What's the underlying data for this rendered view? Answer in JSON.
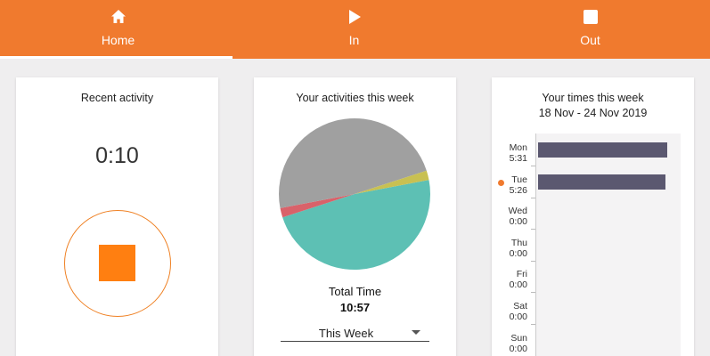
{
  "nav": {
    "tabs": [
      {
        "label": "Home",
        "icon": "home-icon"
      },
      {
        "label": "In",
        "icon": "play-icon"
      },
      {
        "label": "Out",
        "icon": "stop-icon"
      }
    ],
    "active": "Home"
  },
  "recent": {
    "title": "Recent activity",
    "timer": "0:10",
    "stop_icon": "stop-icon"
  },
  "activities": {
    "title": "Your activities this week",
    "total_label": "Total Time",
    "total_value": "10:57",
    "period": "This Week",
    "slices": [
      {
        "color": "#5dc0b4",
        "share": 0.48
      },
      {
        "color": "#d9626a",
        "share": 0.02
      },
      {
        "color": "#a0a0a0",
        "share": 0.48
      },
      {
        "color": "#c8c052",
        "share": 0.02
      }
    ]
  },
  "times": {
    "title": "Your times this week",
    "range": "18 Nov - 24 Nov 2019",
    "days": [
      {
        "day": "Mon",
        "time": "5:31",
        "hours": 5.52
      },
      {
        "day": "Tue",
        "time": "5:26",
        "hours": 5.43,
        "today": true
      },
      {
        "day": "Wed",
        "time": "0:00",
        "hours": 0
      },
      {
        "day": "Thu",
        "time": "0:00",
        "hours": 0
      },
      {
        "day": "Fri",
        "time": "0:00",
        "hours": 0
      },
      {
        "day": "Sat",
        "time": "0:00",
        "hours": 0
      },
      {
        "day": "Sun",
        "time": "0:00",
        "hours": 0
      }
    ]
  },
  "colors": {
    "accent": "#f07a2e",
    "bar": "#5b5870",
    "stop": "#ff7f11"
  }
}
